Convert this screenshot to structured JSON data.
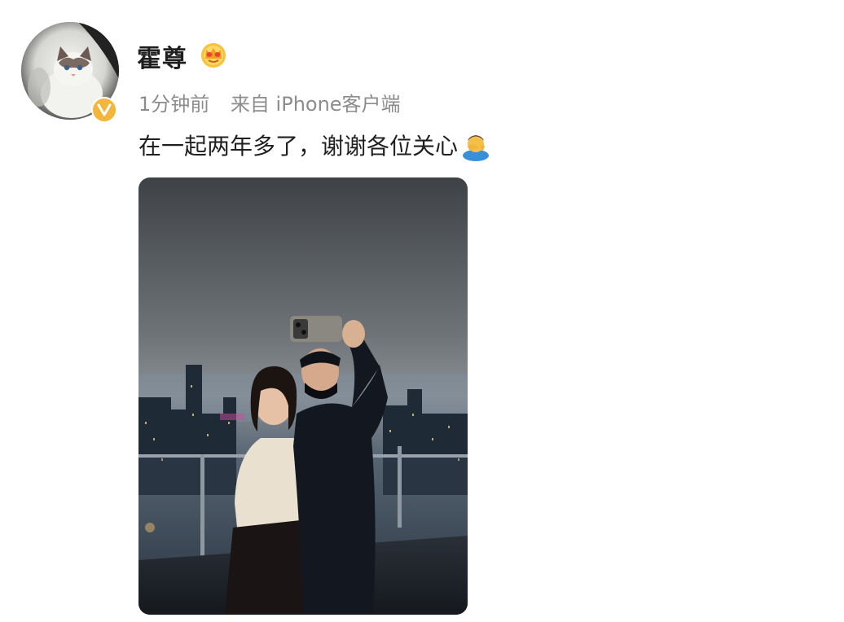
{
  "post": {
    "author": {
      "name": "霍尊",
      "avatar": "cat-avatar",
      "verified_icon": "verified-v-icon",
      "member_icon": "crown-icon"
    },
    "meta": {
      "time": "1分钟前",
      "source": "来自 iPhone客户端"
    },
    "text": "在一起两年多了，谢谢各位关心",
    "text_emoji": "facepalm-emoji-icon",
    "image": {
      "description_icon": "selfie-photo"
    }
  },
  "colors": {
    "meta_gray": "#8c8c8c",
    "badge_gold": "#f3b53a",
    "text": "#1f1f1f"
  }
}
